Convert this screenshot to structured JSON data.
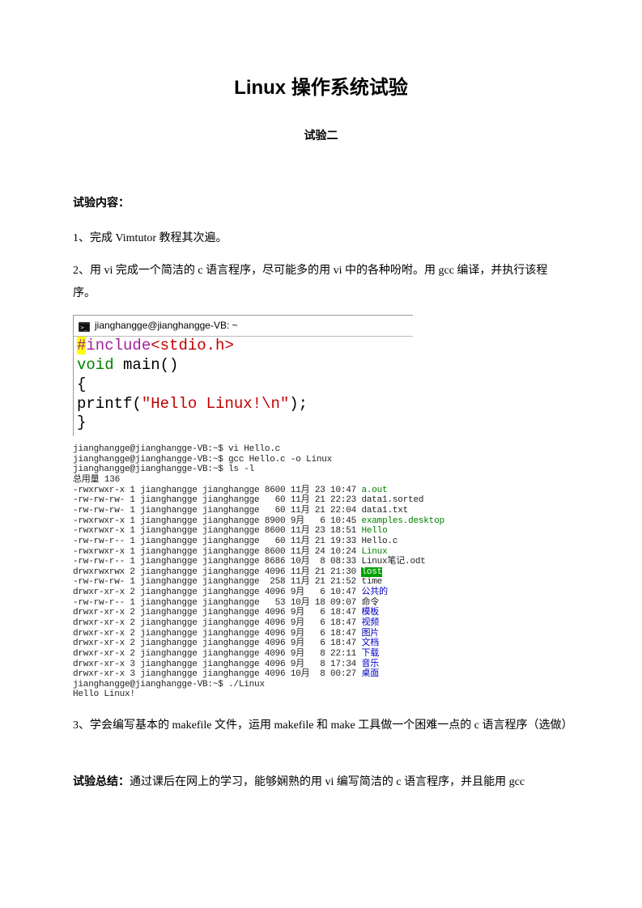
{
  "title": "Linux 操作系统试验",
  "subtitle": "试验二",
  "section1_heading": "试验内容：",
  "para1": "1、完成 Vimtutor 教程其次遍。",
  "para2": "2、用 vi 完成一个简洁的 c 语言程序，尽可能多的用 vi 中的各种吩咐。用 gcc 编译，并执行该程序。",
  "code_window": {
    "titlebar": "jianghangge@jianghangge-VB: ~",
    "hash": "#",
    "include": "include",
    "lt": "<",
    "stdio": "stdio.h",
    "gt": ">",
    "void": "void",
    "main_sig": " main()",
    "lbrace": "{",
    "printf": "printf(",
    "str": "\"Hello Linux!\\n\"",
    "close": ");",
    "rbrace": "}"
  },
  "terminal": {
    "l1": "jianghangge@jianghangge-VB:~$ vi Hello.c",
    "l2": "jianghangge@jianghangge-VB:~$ gcc Hello.c -o Linux",
    "l3": "jianghangge@jianghangge-VB:~$ ls -l",
    "l4": "总用量 136",
    "r1a": "-rwxrwxr-x 1 jianghangge jianghangge 8600 11月 23 10:47 ",
    "r1b": "a.out",
    "r2a": "-rw-rw-rw- 1 jianghangge jianghangge   60 11月 21 22:23 data1.sorted",
    "r3a": "-rw-rw-rw- 1 jianghangge jianghangge   60 11月 21 22:04 data1.txt",
    "r4a": "-rwxrwxr-x 1 jianghangge jianghangge 8900 9月   6 10:45 ",
    "r4b": "examples.desktop",
    "r5a": "-rwxrwxr-x 1 jianghangge jianghangge 8600 11月 23 18:51 ",
    "r5b": "Hello",
    "r6a": "-rw-rw-r-- 1 jianghangge jianghangge   60 11月 21 19:33 Hello.c",
    "r7a": "-rwxrwxr-x 1 jianghangge jianghangge 8600 11月 24 10:24 ",
    "r7b": "Linux",
    "r8a": "-rw-rw-r-- 1 jianghangge jianghangge 8686 10月  8 08:33 Linux笔记.odt",
    "r9a": "drwxrwxrwx 2 jianghangge jianghangge 4096 11月 21 21:30 ",
    "r9b": "lost",
    "r10a": "-rw-rw-rw- 1 jianghangge jianghangge  258 11月 21 21:52 time",
    "r11a": "drwxr-xr-x 2 jianghangge jianghangge 4096 9月   6 10:47 ",
    "r11b": "公共的",
    "r12a": "-rw-rw-r-- 1 jianghangge jianghangge   53 10月 18 09:07 命令",
    "r13a": "drwxr-xr-x 2 jianghangge jianghangge 4096 9月   6 18:47 ",
    "r13b": "模板",
    "r14a": "drwxr-xr-x 2 jianghangge jianghangge 4096 9月   6 18:47 ",
    "r14b": "视频",
    "r15a": "drwxr-xr-x 2 jianghangge jianghangge 4096 9月   6 18:47 ",
    "r15b": "图片",
    "r16a": "drwxr-xr-x 2 jianghangge jianghangge 4096 9月   6 18:47 ",
    "r16b": "文档",
    "r17a": "drwxr-xr-x 2 jianghangge jianghangge 4096 9月   8 22:11 ",
    "r17b": "下载",
    "r18a": "drwxr-xr-x 3 jianghangge jianghangge 4096 9月   8 17:34 ",
    "r18b": "音乐",
    "r19a": "drwxr-xr-x 3 jianghangge jianghangge 4096 10月  8 00:27 ",
    "r19b": "桌面",
    "l20": "jianghangge@jianghangge-VB:~$ ./Linux",
    "l21": "Hello Linux!"
  },
  "para3": "3、学会编写基本的 makefile 文件，运用 makefile  和 make 工具做一个困难一点的 c 语言程序（选做）",
  "summary_label": "试验总结：",
  "summary_text": "通过课后在网上的学习，能够娴熟的用 vi 编写简洁的 c 语言程序，并且能用 gcc"
}
